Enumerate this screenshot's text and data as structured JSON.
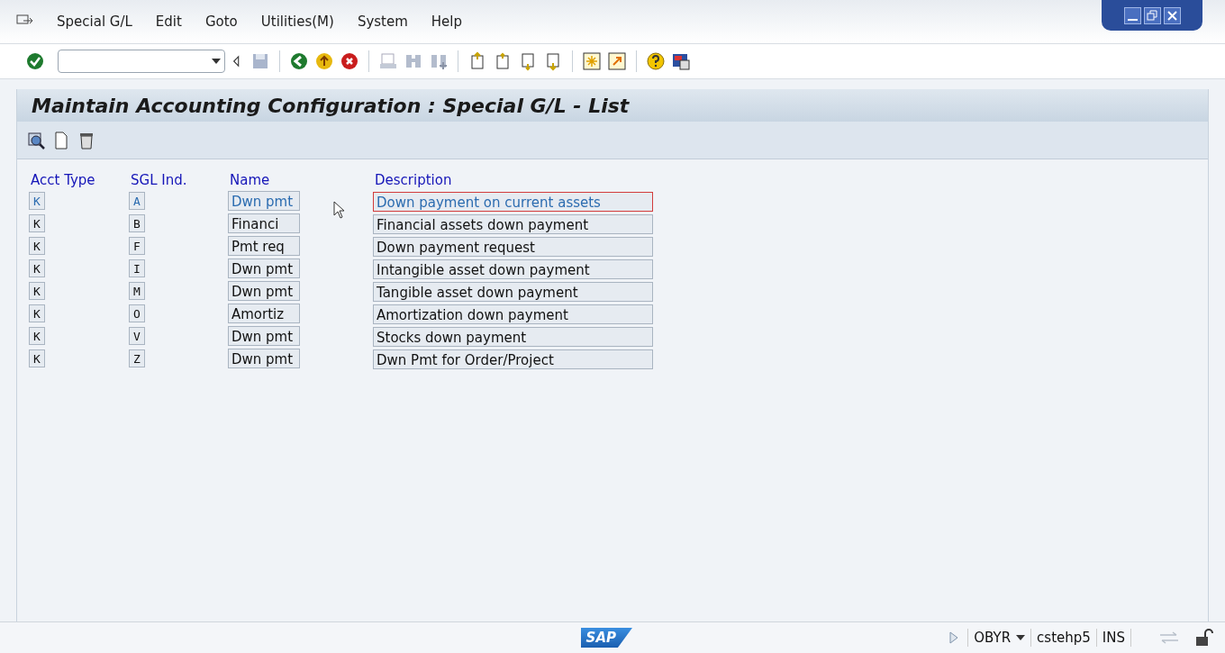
{
  "menu": [
    "Special G/L",
    "Edit",
    "Goto",
    "Utilities(M)",
    "System",
    "Help"
  ],
  "title": "Maintain Accounting Configuration : Special G/L - List",
  "table": {
    "columns": [
      "Acct Type",
      "SGL Ind.",
      "Name",
      "Description"
    ],
    "rows": [
      {
        "acct_type": "K",
        "sgl_ind": "A",
        "name": "Dwn pmt",
        "description": "Down payment on current assets",
        "selected": true
      },
      {
        "acct_type": "K",
        "sgl_ind": "B",
        "name": "Financi",
        "description": "Financial assets down payment",
        "selected": false
      },
      {
        "acct_type": "K",
        "sgl_ind": "F",
        "name": "Pmt req",
        "description": "Down payment request",
        "selected": false
      },
      {
        "acct_type": "K",
        "sgl_ind": "I",
        "name": "Dwn pmt",
        "description": "Intangible asset down payment",
        "selected": false
      },
      {
        "acct_type": "K",
        "sgl_ind": "M",
        "name": "Dwn pmt",
        "description": "Tangible asset down payment",
        "selected": false
      },
      {
        "acct_type": "K",
        "sgl_ind": "O",
        "name": "Amortiz",
        "description": "Amortization down payment",
        "selected": false
      },
      {
        "acct_type": "K",
        "sgl_ind": "V",
        "name": "Dwn pmt",
        "description": "Stocks down payment",
        "selected": false
      },
      {
        "acct_type": "K",
        "sgl_ind": "Z",
        "name": "Dwn pmt",
        "description": "Dwn Pmt for Order/Project",
        "selected": false
      }
    ]
  },
  "logo": "SAP",
  "status_bar": {
    "transaction": "OBYR",
    "server": "cstehp5",
    "mode": "INS"
  }
}
